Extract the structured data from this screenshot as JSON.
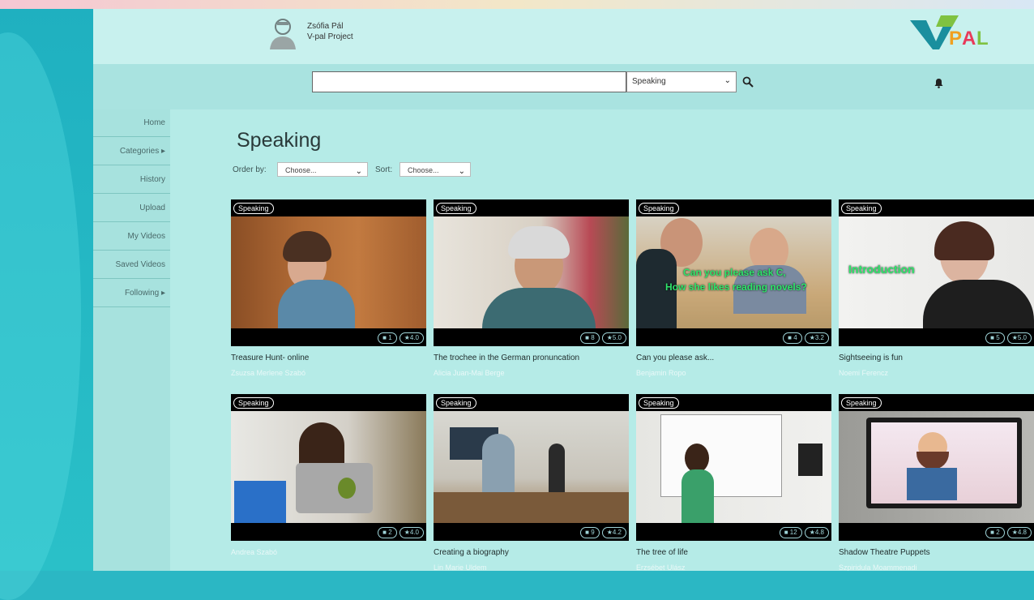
{
  "user": {
    "name": "Zsófia Pál",
    "project": "V-pal Project"
  },
  "logo": {
    "text": "PAL",
    "colors": [
      "#1a8f9e",
      "#f0a020",
      "#e83a5a",
      "#7fc241"
    ]
  },
  "search": {
    "value": "",
    "category": "Speaking"
  },
  "sidebar": {
    "items": [
      {
        "label": "Home"
      },
      {
        "label": "Categories ▸"
      },
      {
        "label": "History"
      },
      {
        "label": "Upload"
      },
      {
        "label": "My Videos"
      },
      {
        "label": "Saved Videos"
      },
      {
        "label": "Following ▸"
      }
    ]
  },
  "main": {
    "title": "Speaking",
    "order_label": "Order by:",
    "order_value": "Choose...",
    "sort_label": "Sort:",
    "sort_value": "Choose..."
  },
  "videos": [
    {
      "tag": "Speaking",
      "title": "Treasure Hunt- online",
      "author": "Zsuzsa Merlene Szabó",
      "comments": "1",
      "rating": "4.0"
    },
    {
      "tag": "Speaking",
      "title": "The trochee in the German pronuncation",
      "author": "Alicia Juan-Mai Berge",
      "comments": "8",
      "rating": "5.0"
    },
    {
      "tag": "Speaking",
      "title": "Can you please ask...",
      "author": "Benjamin Ropo",
      "comments": "4",
      "rating": "3.2",
      "overlay": [
        "Can you please ask C,",
        "How she likes reading novels?"
      ]
    },
    {
      "tag": "Speaking",
      "title": "Sightseeing is fun",
      "author": "Noemi Ferencz",
      "comments": "5",
      "rating": "5.0",
      "overlay": [
        "Introduction"
      ]
    },
    {
      "tag": "Speaking",
      "title": "",
      "author": "Andrea Szabó",
      "comments": "2",
      "rating": "4.0"
    },
    {
      "tag": "Speaking",
      "title": "Creating a biography",
      "author": "Lin Marie Uldem",
      "comments": "9",
      "rating": "4.2"
    },
    {
      "tag": "Speaking",
      "title": "The tree of life",
      "author": "Erzsébet Ulász",
      "comments": "12",
      "rating": "4.8"
    },
    {
      "tag": "Speaking",
      "title": "Shadow Theatre Puppets",
      "author": "Szpiridula Moammenadi",
      "comments": "2",
      "rating": "4.8"
    }
  ]
}
